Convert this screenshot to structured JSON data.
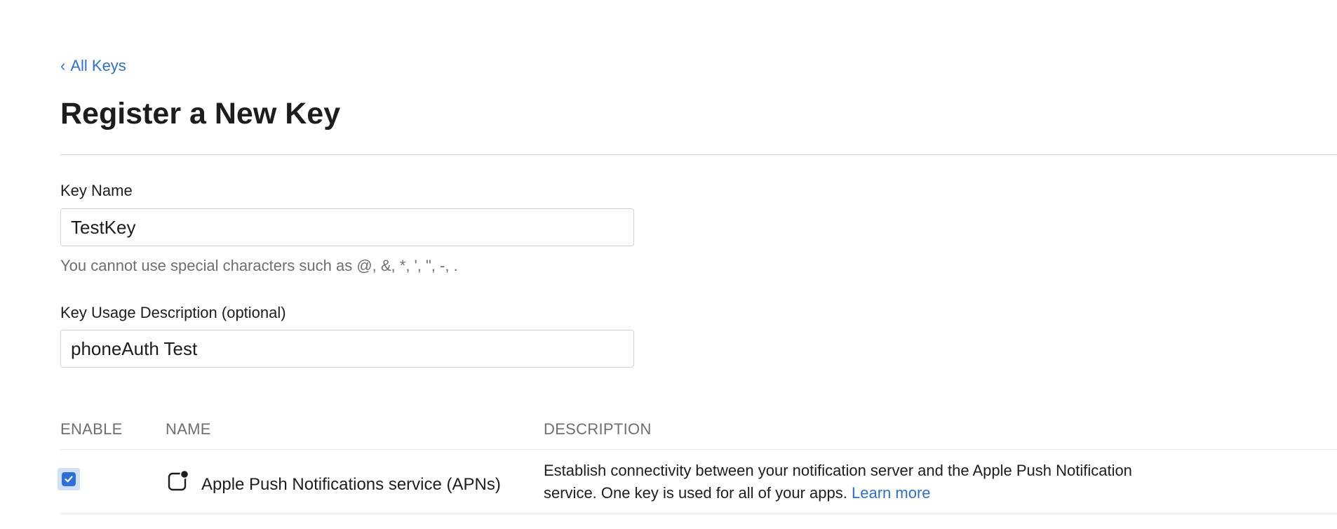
{
  "back_link": {
    "label": "All Keys",
    "icon": "chevron-left-icon"
  },
  "page_title": "Register a New Key",
  "key_name": {
    "label": "Key Name",
    "value": "TestKey",
    "hint": "You cannot use special characters such as @, &, *, ', \", -, ."
  },
  "key_usage": {
    "label": "Key Usage Description (optional)",
    "value": "phoneAuth Test"
  },
  "table": {
    "headers": {
      "enable": "ENABLE",
      "name": "NAME",
      "description": "DESCRIPTION"
    },
    "rows": [
      {
        "enabled": true,
        "icon": "notification-icon",
        "name": "Apple Push Notifications service (APNs)",
        "description": "Establish connectivity between your notification server and the Apple Push Notification service. One key is used for all of your apps.",
        "link": "Learn more"
      }
    ]
  },
  "colors": {
    "link": "#2f70c8",
    "checkbox": "#2f6fd6",
    "text": "#1d1d1f",
    "muted": "#6e6e73"
  }
}
